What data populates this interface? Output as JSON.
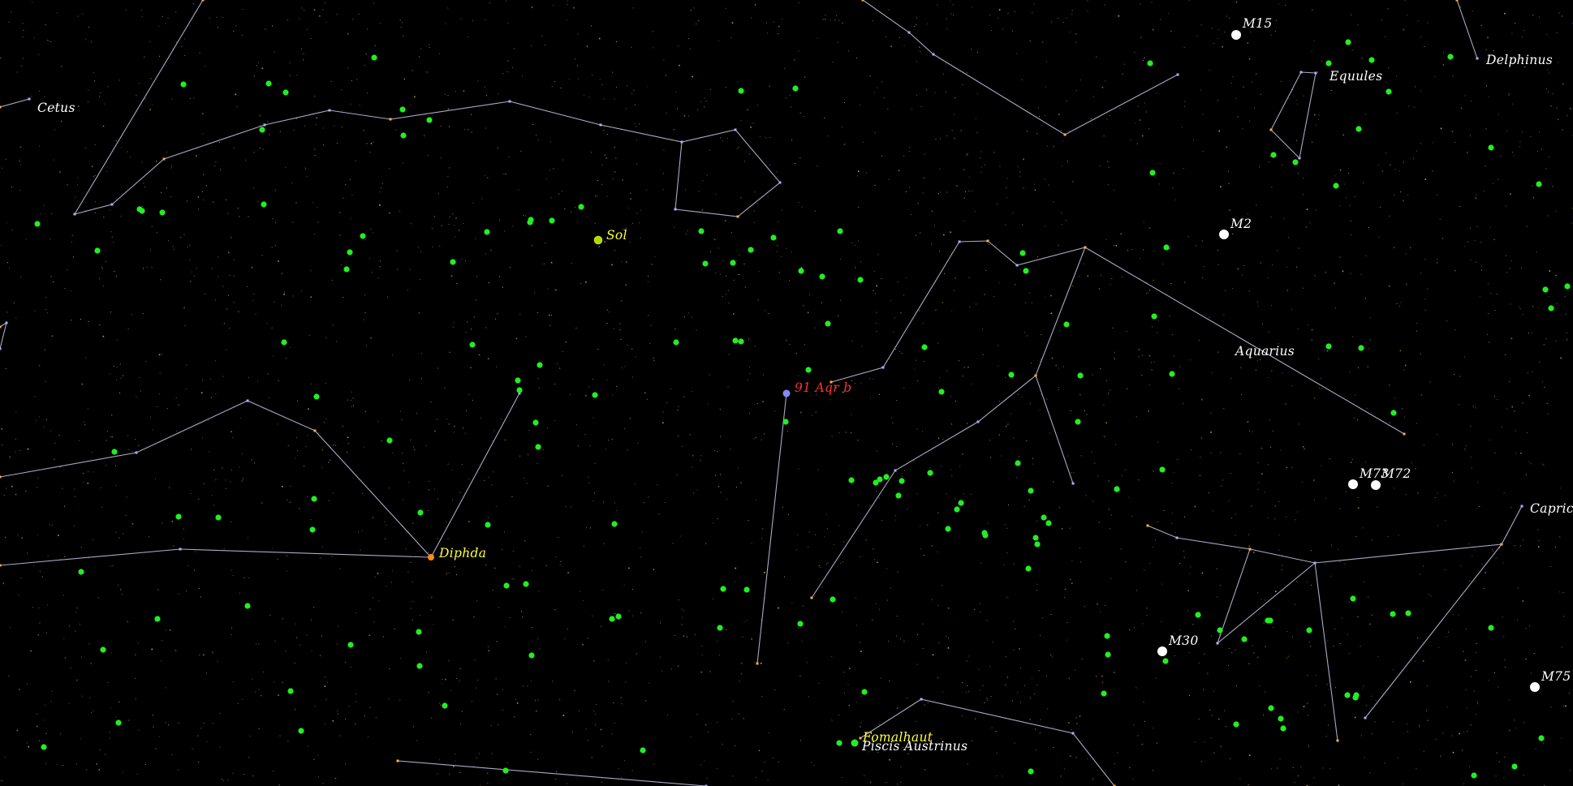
{
  "view": {
    "background": "#000000",
    "line_color": "#c8c8e8",
    "colors": {
      "constellation_label": "#ffffff",
      "named_star_label": "#ffff3c",
      "messier_label": "#ffffff",
      "selected_label": "#ff3030",
      "exoplanet_host": "#22ee22",
      "messier_object": "#ffffff",
      "selected_object": "#8888ff"
    }
  },
  "constellations": [
    {
      "name": "Cetus"
    },
    {
      "name": "Aquarius"
    },
    {
      "name": "Equules"
    },
    {
      "name": "Delphinus"
    },
    {
      "name": "Capricornus"
    },
    {
      "name": "Piscis Austrinus"
    }
  ],
  "named_stars": [
    {
      "name": "Sol",
      "icon": "sun-icon"
    },
    {
      "name": "Diphda",
      "icon": "star-icon"
    },
    {
      "name": "Fomalhaut",
      "icon": "star-icon"
    }
  ],
  "messier_objects": [
    {
      "name": "M15"
    },
    {
      "name": "M2"
    },
    {
      "name": "M73"
    },
    {
      "name": "M72"
    },
    {
      "name": "M30"
    },
    {
      "name": "M75"
    }
  ],
  "selected_object": {
    "name": "91 Aqr b",
    "icon": "selected-star-icon"
  }
}
